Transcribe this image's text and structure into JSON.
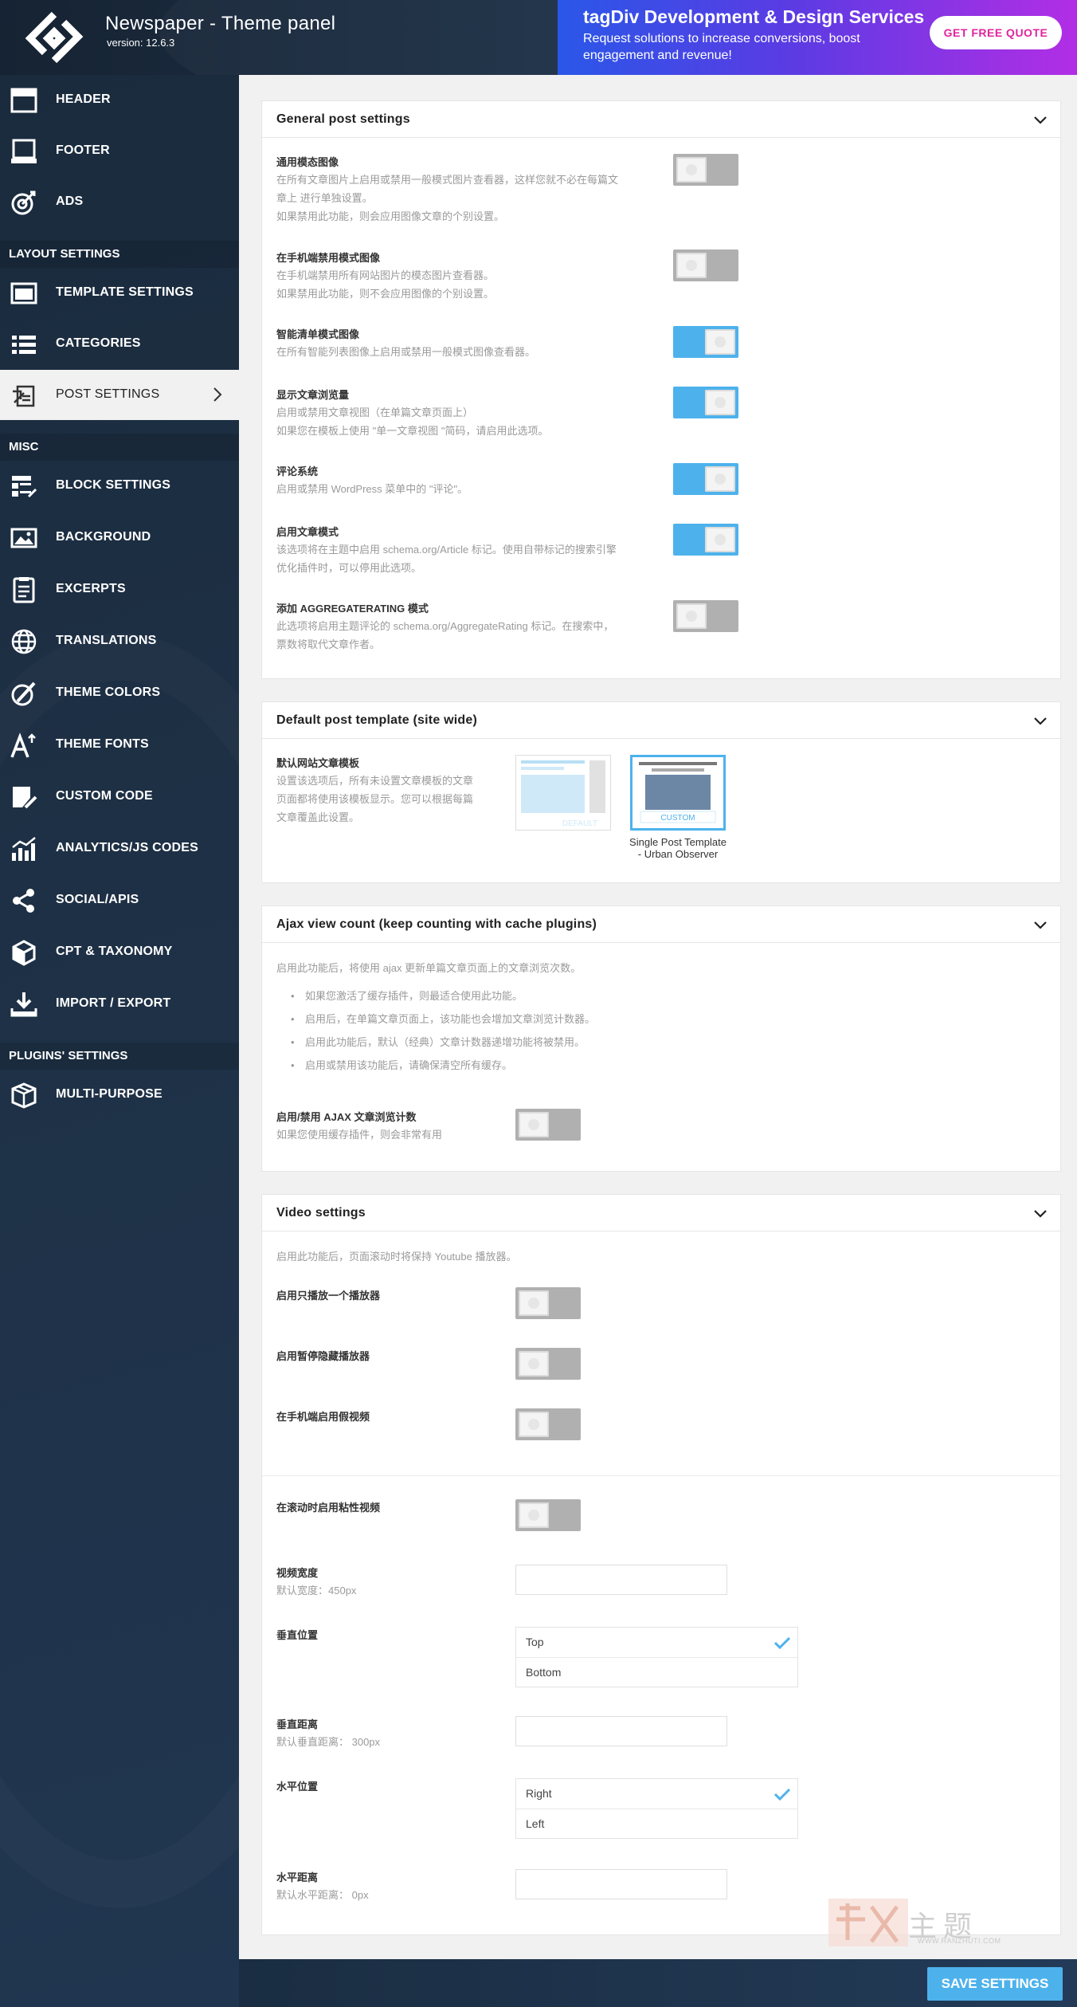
{
  "header": {
    "title": "Newspaper - Theme panel",
    "version": "version: 12.6.3",
    "promo_title": "tagDiv Development & Design Services",
    "promo_subtitle": "Request solutions to increase conversions, boost engagement and revenue!",
    "promo_button": "GET FREE QUOTE"
  },
  "sidebar": {
    "items_top": [
      {
        "label": "HEADER",
        "icon": "header-icon"
      },
      {
        "label": "FOOTER",
        "icon": "footer-icon"
      },
      {
        "label": "ADS",
        "icon": "target-icon"
      }
    ],
    "section_layout": "LAYOUT SETTINGS",
    "items_layout": [
      {
        "label": "TEMPLATE SETTINGS",
        "icon": "template-icon"
      },
      {
        "label": "CATEGORIES",
        "icon": "list-icon"
      },
      {
        "label": "POST SETTINGS",
        "icon": "post-icon",
        "active": true
      }
    ],
    "section_misc": "MISC",
    "items_misc": [
      {
        "label": "BLOCK SETTINGS",
        "icon": "block-icon"
      },
      {
        "label": "BACKGROUND",
        "icon": "image-icon"
      },
      {
        "label": "EXCERPTS",
        "icon": "excerpt-icon"
      },
      {
        "label": "TRANSLATIONS",
        "icon": "globe-icon"
      },
      {
        "label": "THEME COLORS",
        "icon": "color-icon"
      },
      {
        "label": "THEME FONTS",
        "icon": "font-icon"
      },
      {
        "label": "CUSTOM CODE",
        "icon": "code-icon"
      },
      {
        "label": "ANALYTICS/JS CODES",
        "icon": "analytics-icon"
      },
      {
        "label": "SOCIAL/APIS",
        "icon": "share-icon"
      },
      {
        "label": "CPT & TAXONOMY",
        "icon": "cube-icon"
      },
      {
        "label": "IMPORT / EXPORT",
        "icon": "download-icon"
      }
    ],
    "section_plugins": "PLUGINS' SETTINGS",
    "items_plugins": [
      {
        "label": "MULTI-PURPOSE",
        "icon": "box-icon"
      }
    ]
  },
  "general": {
    "title": "General post settings",
    "rows": [
      {
        "label": "通用模态图像",
        "desc1": "在所有文章图片上启用或禁用一般模式图片查看器，这样您就不必在每篇文",
        "desc2": "章上 进行单独设置。",
        "desc3": "如果禁用此功能，则会应用图像文章的个别设置。",
        "on": false
      },
      {
        "label": "在手机端禁用模式图像",
        "desc1": "在手机端禁用所有网站图片的模态图片查看器。",
        "desc2": "如果禁用此功能，则不会应用图像的个别设置。",
        "desc3": "",
        "on": false
      },
      {
        "label": "智能清单模式图像",
        "desc1": "在所有智能列表图像上启用或禁用一般模式图像查看器。",
        "desc2": "",
        "desc3": "",
        "on": true
      },
      {
        "label": "显示文章浏览量",
        "desc1": "启用或禁用文章视图（在单篇文章页面上）",
        "desc2": "如果您在模板上使用 \"单一文章视图 \"简码，请启用此选项。",
        "desc3": "",
        "on": true
      },
      {
        "label": "评论系统",
        "desc1": "启用或禁用 WordPress 菜单中的 \"评论\"。",
        "desc2": "",
        "desc3": "",
        "on": true
      },
      {
        "label": "启用文章模式",
        "desc1": "该选项将在主题中启用 schema.org/Article 标记。使用自带标记的搜索引擎",
        "desc2": "优化插件时，可以停用此选项。",
        "desc3": "",
        "on": true
      },
      {
        "label": "添加 AGGREGATERATING 模式",
        "desc1": "此选项将启用主题评论的 schema.org/AggregateRating 标记。在搜索中，",
        "desc2": "票数将取代文章作者。",
        "desc3": "",
        "on": false
      }
    ]
  },
  "template": {
    "title": "Default post template (site wide)",
    "label": "默认网站文章模板",
    "desc1": "设置该选项后，所有未设置文章模板的文章",
    "desc2": "页面都将使用该模板显示。您可以根据每篇",
    "desc3": "文章覆盖此设置。",
    "thumb_default": "DEFAULT",
    "thumb_custom": "CUSTOM",
    "custom_caption": "Single Post Template - Urban Observer"
  },
  "ajax": {
    "title": "Ajax view count (keep counting with cache plugins)",
    "intro": "启用此功能后，将使用 ajax 更新单篇文章页面上的文章浏览次数。",
    "bullets": [
      "如果您激活了缓存插件，则最适合使用此功能。",
      "启用后，在单篇文章页面上，该功能也会增加文章浏览计数器。",
      "启用此功能后，默认（经典）文章计数器递增功能将被禁用。",
      "启用或禁用该功能后，请确保清空所有缓存。"
    ],
    "toggle_label": "启用/禁用 AJAX 文章浏览计数",
    "toggle_desc": "如果您使用缓存插件，则会非常有用",
    "on": false
  },
  "video": {
    "title": "Video settings",
    "intro": "启用此功能后，页面滚动时将保持 Youtube 播放器。",
    "rows": [
      {
        "label": "启用只播放一个播放器",
        "on": false
      },
      {
        "label": "启用暂停隐藏播放器",
        "on": false
      },
      {
        "label": "在手机端启用假视频",
        "on": false
      }
    ],
    "sticky_label": "在滚动时启用粘性视频",
    "sticky_on": false,
    "width_label": "视频宽度",
    "width_desc": "默认宽度：450px",
    "width_value": "",
    "vpos_label": "垂直位置",
    "vpos_options": [
      "Top",
      "Bottom"
    ],
    "vpos_selected": "Top",
    "vdist_label": "垂直距离",
    "vdist_desc": "默认垂直距离： 300px",
    "vdist_value": "",
    "hpos_label": "水平位置",
    "hpos_options": [
      "Right",
      "Left"
    ],
    "hpos_selected": "Right",
    "hdist_label": "水平距离",
    "hdist_desc": "默认水平距离： 0px",
    "hdist_value": ""
  },
  "footer": {
    "save_label": "SAVE SETTINGS"
  },
  "watermark": {
    "text_big": "主题",
    "url": "WWW.RANZHUTI.COM"
  },
  "colors": {
    "accent": "#4db2ec",
    "sidebar_bg": "#1e3045",
    "toggle_off": "#b0b0b0"
  }
}
